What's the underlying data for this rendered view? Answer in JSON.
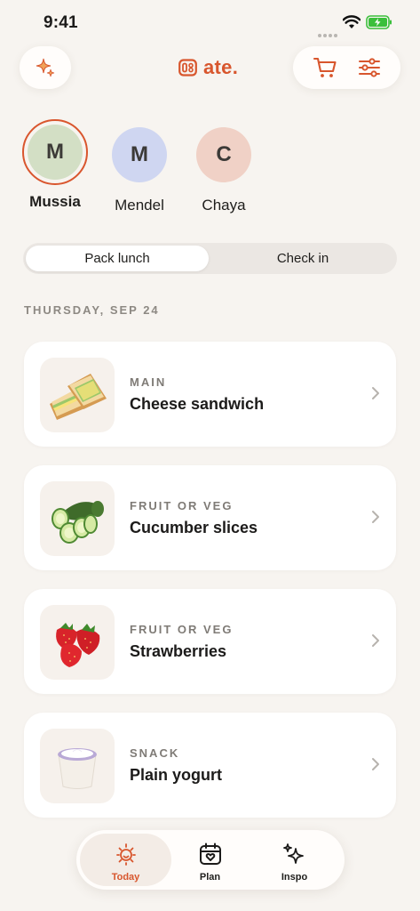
{
  "status": {
    "time": "9:41"
  },
  "app": {
    "logo_text": "ate.",
    "accent": "#d8562d"
  },
  "header": {
    "sparkle_icon": "sparkle-icon",
    "cart_icon": "cart-icon",
    "filter_icon": "sliders-icon"
  },
  "kids": [
    {
      "initial": "M",
      "name": "Mussia",
      "color": "#d3dfc5",
      "selected": true
    },
    {
      "initial": "M",
      "name": "Mendel",
      "color": "#cfd6f1",
      "selected": false
    },
    {
      "initial": "C",
      "name": "Chaya",
      "color": "#f0d1c6",
      "selected": false
    }
  ],
  "segments": {
    "active": "Pack lunch",
    "inactive": "Check in"
  },
  "date_label": "THURSDAY, SEP 24",
  "items": [
    {
      "category": "MAIN",
      "title": "Cheese sandwich",
      "image": "sandwich"
    },
    {
      "category": "FRUIT OR VEG",
      "title": "Cucumber slices",
      "image": "cucumber"
    },
    {
      "category": "FRUIT OR VEG",
      "title": "Strawberries",
      "image": "strawberry"
    },
    {
      "category": "SNACK",
      "title": "Plain yogurt",
      "image": "yogurt"
    }
  ],
  "nav": [
    {
      "label": "Today",
      "icon": "sun-icon",
      "active": true
    },
    {
      "label": "Plan",
      "icon": "calendar-heart-icon",
      "active": false
    },
    {
      "label": "Inspo",
      "icon": "sparkles-icon",
      "active": false
    }
  ]
}
